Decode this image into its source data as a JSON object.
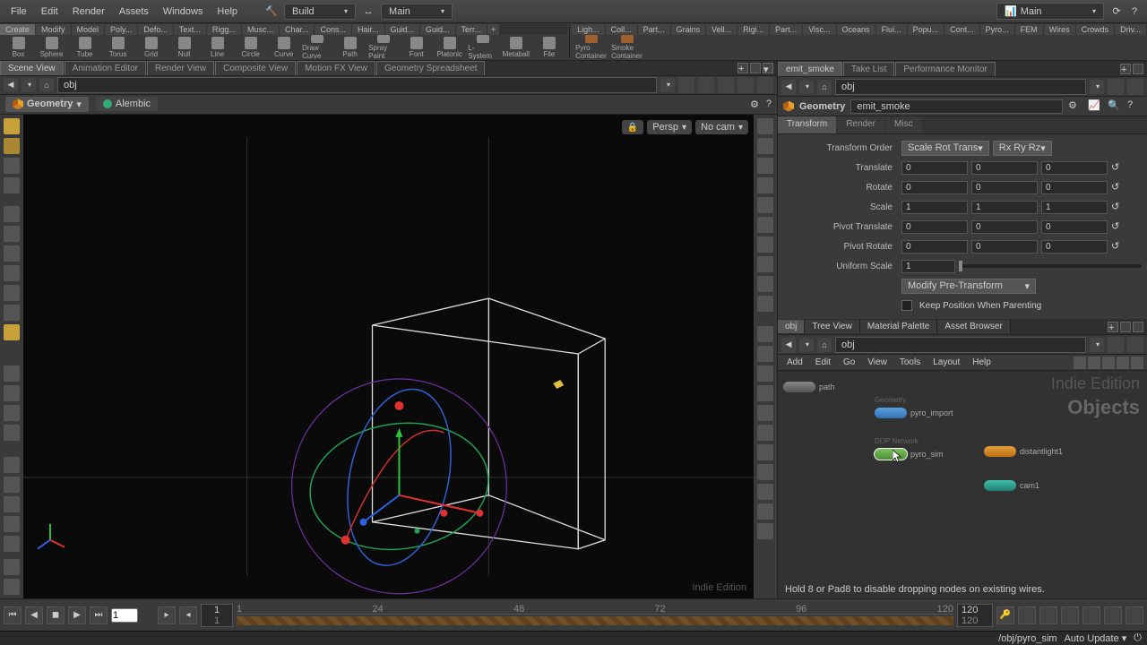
{
  "menu": {
    "file": "File",
    "edit": "Edit",
    "render": "Render",
    "assets": "Assets",
    "windows": "Windows",
    "help": "Help"
  },
  "top_dropdowns": {
    "build": "Build",
    "main": "Main",
    "scene": "Main"
  },
  "shelf_tabs_left": [
    "Create",
    "Modify",
    "Model",
    "Poly...",
    "Defo...",
    "Text...",
    "Rigg...",
    "Musc...",
    "Char...",
    "Cons...",
    "Hair...",
    "Guid...",
    "Guid...",
    "Terr..."
  ],
  "shelf_tools_left": [
    "Box",
    "Sphere",
    "Tube",
    "Torus",
    "Grid",
    "Null",
    "Line",
    "Circle",
    "Curve",
    "Draw Curve",
    "Path",
    "Spray Paint",
    "Font",
    "Platonic",
    "L-System",
    "Metaball",
    "File"
  ],
  "shelf_tabs_right": [
    "Ligh...",
    "Coll...",
    "Part...",
    "Grains",
    "Vell...",
    "Rigi...",
    "Part...",
    "Visc...",
    "Oceans",
    "Flui...",
    "Popu...",
    "Cont...",
    "Pyro...",
    "FEM",
    "Wires",
    "Crowds",
    "Driv..."
  ],
  "shelf_tools_right": [
    "Pyro Container",
    "Smoke Container"
  ],
  "pane_tabs_left": [
    "Scene View",
    "Animation Editor",
    "Render View",
    "Composite View",
    "Motion FX View",
    "Geometry Spreadsheet"
  ],
  "pane_tabs_right": [
    "emit_smoke",
    "Take List",
    "Performance Monitor"
  ],
  "path_left": "obj",
  "path_right": "obj",
  "vp_header": {
    "type": "Geometry",
    "subtype": "Alembic",
    "persp": "Persp",
    "cam": "No cam"
  },
  "watermark": "Indie Edition",
  "param": {
    "icon_label": "Geometry",
    "name": "emit_smoke",
    "tabs": [
      "Transform",
      "Render",
      "Misc"
    ],
    "order_label": "Transform Order",
    "order_v1": "Scale Rot Trans",
    "order_v2": "Rx Ry Rz",
    "translate_label": "Translate",
    "translate": [
      "0",
      "0",
      "0"
    ],
    "rotate_label": "Rotate",
    "rotate": [
      "0",
      "0",
      "0"
    ],
    "scale_label": "Scale",
    "scale": [
      "1",
      "1",
      "1"
    ],
    "pivott_label": "Pivot Translate",
    "pivott": [
      "0",
      "0",
      "0"
    ],
    "pivotr_label": "Pivot Rotate",
    "pivotr": [
      "0",
      "0",
      "0"
    ],
    "uscale_label": "Uniform Scale",
    "uscale": "1",
    "modify_label": "Modify Pre-Transform",
    "keep_label": "Keep Position When Parenting"
  },
  "net_tabs": [
    "obj",
    "Tree View",
    "Material Palette",
    "Asset Browser"
  ],
  "net_menu": [
    "Add",
    "Edit",
    "Go",
    "View",
    "Tools",
    "Layout",
    "Help"
  ],
  "net_path": "obj",
  "net_big1": "Indie Edition",
  "net_big2": "Objects",
  "nodes": {
    "path": "path",
    "pyro_import_type": "Geometry",
    "pyro_import": "pyro_import",
    "pyro_sim_type": "DOP Network",
    "pyro_sim": "pyro_sim",
    "light": "distantlight1",
    "cam": "cam1"
  },
  "net_hint": "Hold 8 or Pad8 to disable dropping nodes on existing wires.",
  "timeline": {
    "start_top": "1",
    "start_bot": "1",
    "end_top": "120",
    "end_bot": "120",
    "ticks": [
      "1",
      "24",
      "48",
      "72",
      "96",
      "120"
    ],
    "cur": "1"
  },
  "status": {
    "path": "/obj/pyro_sim",
    "auto": "Auto Update"
  }
}
